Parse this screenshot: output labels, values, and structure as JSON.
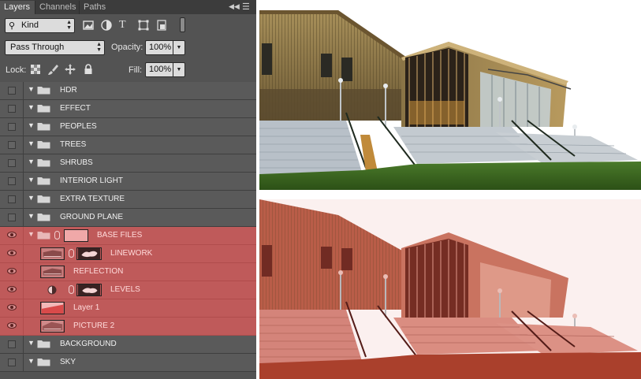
{
  "panel": {
    "tabs": [
      "Layers",
      "Channels",
      "Paths"
    ],
    "kind_label": "Kind",
    "blend_mode": "Pass Through",
    "opacity_label": "Opacity:",
    "opacity_value": "100%",
    "lock_label": "Lock:",
    "fill_label": "Fill:",
    "fill_value": "100%",
    "text_filter_glyph": "T"
  },
  "layers": [
    {
      "name": "HDR",
      "type": "group",
      "visible": false
    },
    {
      "name": "EFFECT",
      "type": "group",
      "visible": false
    },
    {
      "name": "PEOPLES",
      "type": "group",
      "visible": false
    },
    {
      "name": "TREES",
      "type": "group",
      "visible": false
    },
    {
      "name": "SHRUBS",
      "type": "group",
      "visible": false
    },
    {
      "name": "INTERIOR LIGHT",
      "type": "group",
      "visible": false
    },
    {
      "name": "EXTRA TEXTURE",
      "type": "group",
      "visible": false
    },
    {
      "name": "GROUND PLANE",
      "type": "group",
      "visible": false
    },
    {
      "name": "BASE FILES",
      "type": "group-masked",
      "visible": true,
      "highlight": true
    },
    {
      "name": "LINEWORK",
      "type": "layer-masked",
      "visible": true,
      "highlight": true
    },
    {
      "name": "REFLECTION",
      "type": "layer",
      "visible": true,
      "highlight": true
    },
    {
      "name": "LEVELS",
      "type": "adjustment",
      "visible": true,
      "highlight": true
    },
    {
      "name": "Layer 1",
      "type": "layer-red",
      "visible": true,
      "highlight": true
    },
    {
      "name": "PICTURE 2",
      "type": "layer",
      "visible": true,
      "highlight": true
    },
    {
      "name": "BACKGROUND",
      "type": "group",
      "visible": false
    },
    {
      "name": "SKY",
      "type": "group",
      "visible": false
    }
  ],
  "colors": {
    "panel_bg": "#535353",
    "highlight": "#bf5a5a",
    "tint_overlay": "#c8452f"
  }
}
